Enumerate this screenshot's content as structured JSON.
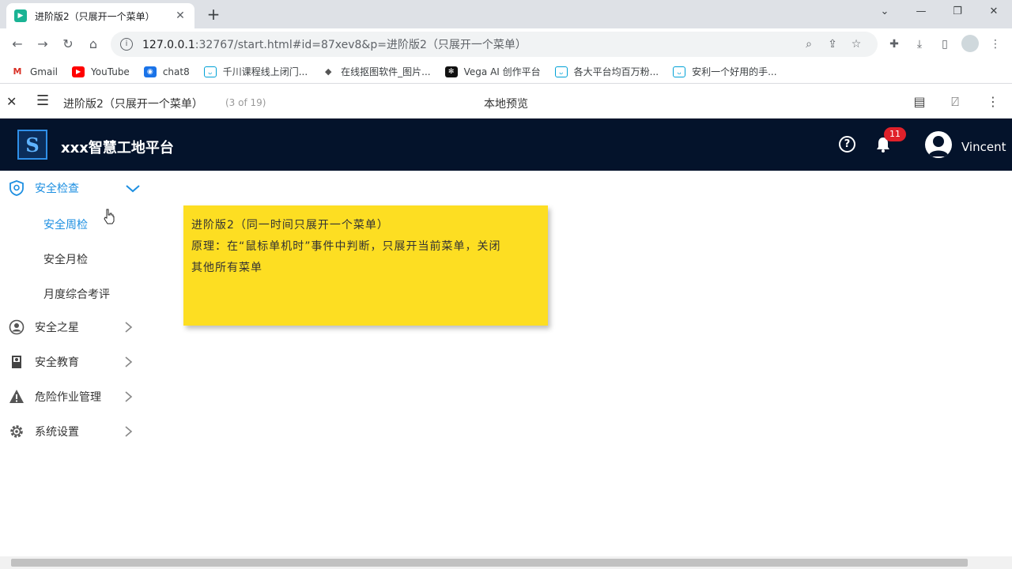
{
  "browser": {
    "tab_title": "进阶版2（只展开一个菜单）",
    "tab_close": "✕",
    "new_tab": "+",
    "url_host": "127.0.0.1",
    "url_rest": ":32767/start.html#id=87xev8&p=进阶版2（只展开一个菜单）",
    "bookmarks": [
      {
        "label": "Gmail",
        "icon": "gmail-icon"
      },
      {
        "label": "YouTube",
        "icon": "youtube-icon"
      },
      {
        "label": "chat8",
        "icon": "chat-icon"
      },
      {
        "label": "千川课程线上闭门...",
        "icon": "bilibili-icon"
      },
      {
        "label": "在线抠图软件_图片...",
        "icon": "layers-icon"
      },
      {
        "label": "Vega AI 创作平台",
        "icon": "vega-icon"
      },
      {
        "label": "各大平台均百万粉...",
        "icon": "bilibili-icon"
      },
      {
        "label": "安利一个好用的手...",
        "icon": "bilibili-icon"
      }
    ]
  },
  "preview": {
    "page_title": "进阶版2（只展开一个菜单）",
    "page_count": "(3 of 19)",
    "center_title": "本地预览"
  },
  "header": {
    "app_title": "xxx智慧工地平台",
    "notification_count": "11",
    "username": "Vincent"
  },
  "sidebar": {
    "items": [
      {
        "label": "安全检查",
        "icon": "shield-icon",
        "expanded": true,
        "children": [
          {
            "label": "安全周检",
            "active": true
          },
          {
            "label": "安全月检"
          },
          {
            "label": "月度综合考评"
          }
        ]
      },
      {
        "label": "安全之星",
        "icon": "user-circle-icon"
      },
      {
        "label": "安全教育",
        "icon": "book-icon"
      },
      {
        "label": "危险作业管理",
        "icon": "warning-icon"
      },
      {
        "label": "系统设置",
        "icon": "gear-icon"
      }
    ]
  },
  "note": {
    "line1": "进阶版2（同一时间只展开一个菜单）",
    "line2": "原理：在“鼠标单机时”事件中判断，只展开当前菜单，关闭",
    "line3": "其他所有菜单"
  },
  "colors": {
    "header_bg": "#04132b",
    "accent": "#1d8fe1",
    "note_bg": "#fdde22",
    "badge": "#e0212a"
  }
}
